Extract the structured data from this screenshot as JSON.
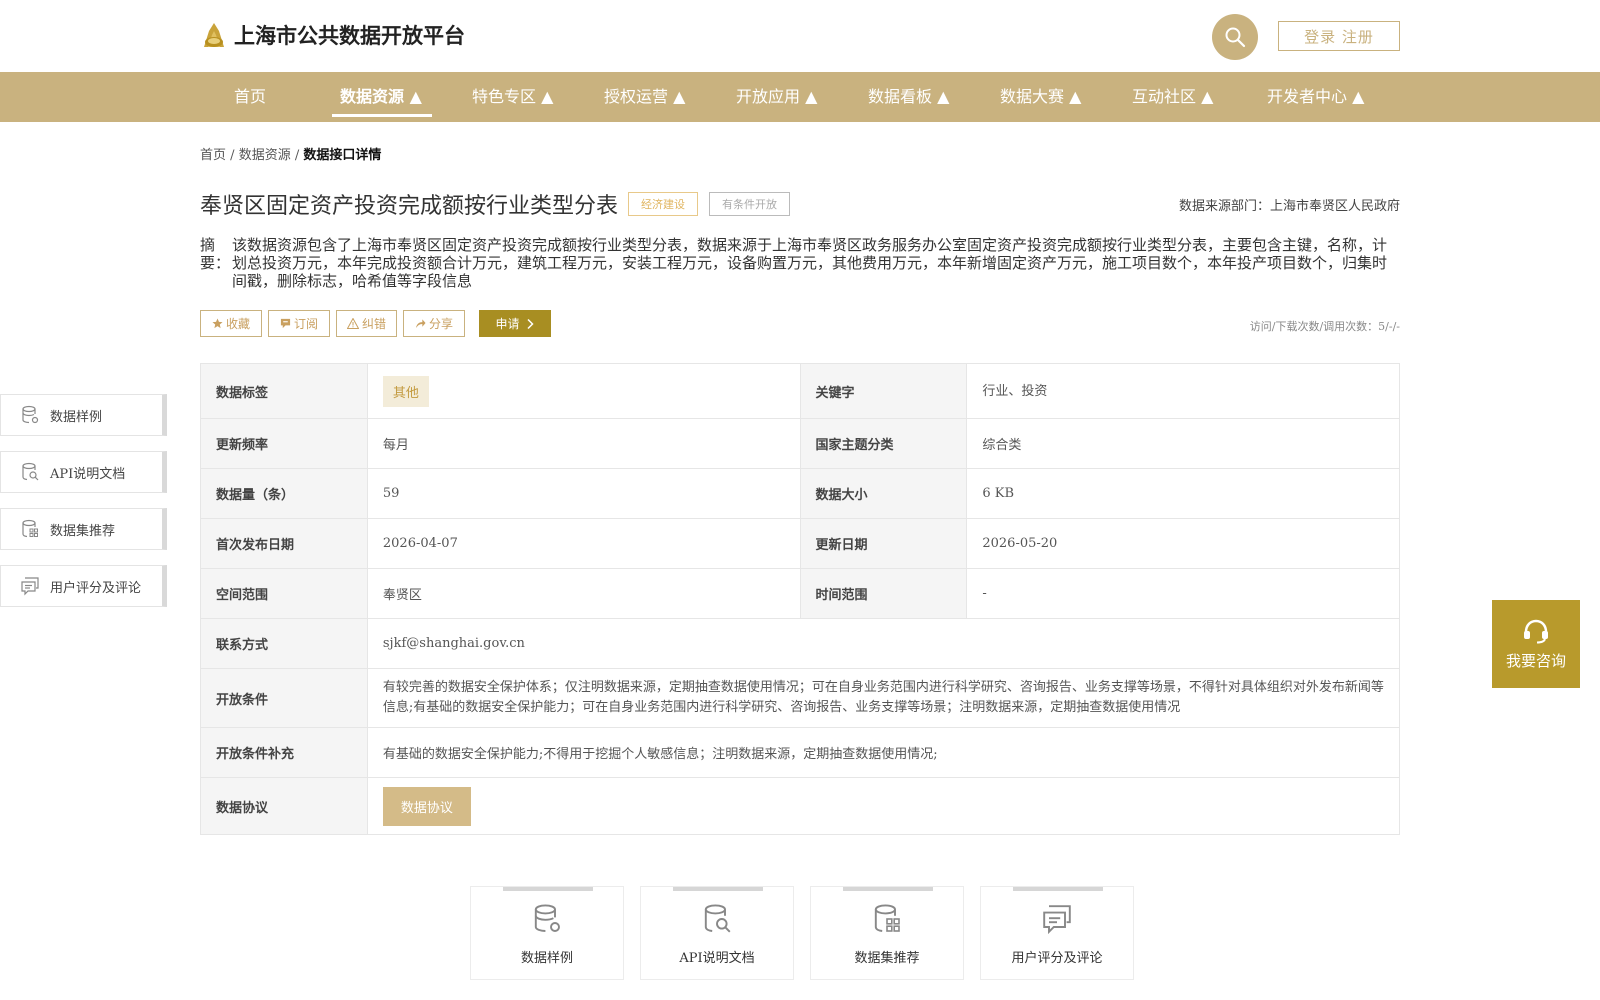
{
  "header": {
    "site_title": "上海市公共数据开放平台",
    "login_label": "登录 注册"
  },
  "nav": {
    "items": [
      "首页",
      "数据资源 ▲",
      "特色专区 ▲",
      "授权运营 ▲",
      "开放应用 ▲",
      "数据看板 ▲",
      "数据大赛 ▲",
      "互动社区 ▲",
      "开发者中心 ▲"
    ],
    "active": "数据资源 ▲"
  },
  "breadcrumb": {
    "home": "首页",
    "sep": "/",
    "section": "数据资源",
    "current": "数据接口详情"
  },
  "dataset": {
    "title": "奉贤区固定资产投资完成额按行业类型分表",
    "tag_topic": "经济建设",
    "tag_open": "有条件开放",
    "source": "数据来源部门：上海市奉贤区人民政府",
    "summary_label": "摘要：",
    "summary": "该数据资源包含了上海市奉贤区固定资产投资完成额按行业类型分表，数据来源于上海市奉贤区政务服务办公室固定资产投资完成额按行业类型分表，主要包含主键，名称，计划总投资万元，本年完成投资额合计万元，建筑工程万元，安装工程万元，设备购置万元，其他费用万元，本年新增固定资产万元，施工项目数个，本年投产项目数个，归集时间戳，删除标志，哈希值等字段信息"
  },
  "actions": {
    "favorite": "收藏",
    "subscribe": "订阅",
    "report": "纠错",
    "share": "分享",
    "apply": "申请",
    "visits": "访问/下载次数/调用次数：5/-/-"
  },
  "table": {
    "data_tag_label": "数据标签",
    "data_tag_value": "其他",
    "keywords_label": "关键字",
    "keywords_value": "行业、投资",
    "freq_label": "更新频率",
    "freq_value": "每月",
    "theme_label": "国家主题分类",
    "theme_value": "综合类",
    "count_label": "数据量（条）",
    "count_value": "59",
    "size_label": "数据大小",
    "size_value": "6 KB",
    "first_pub_label": "首次发布日期",
    "first_pub_value": "2026-04-07",
    "update_label": "更新日期",
    "update_value": "2026-05-20",
    "space_label": "空间范围",
    "space_value": "奉贤区",
    "time_label": "时间范围",
    "time_value": "-",
    "contact_label": "联系方式",
    "contact_value": "sjkf@shanghai.gov.cn",
    "cond_label": "开放条件",
    "cond_value": "有较完善的数据安全保护体系；仅注明数据来源，定期抽查数据使用情况；可在自身业务范围内进行科学研究、咨询报告、业务支撑等场景，不得针对具体组织对外发布新闻等信息;有基础的数据安全保护能力；可在自身业务范围内进行科学研究、咨询报告、业务支撑等场景；注明数据来源，定期抽查数据使用情况",
    "cond_extra_label": "开放条件补充",
    "cond_extra_value": "有基础的数据安全保护能力;不得用于挖掘个人敏感信息；注明数据来源，定期抽查数据使用情况;",
    "protocol_label": "数据协议",
    "protocol_button": "数据协议"
  },
  "side_nav": [
    "数据样例",
    "API说明文档",
    "数据集推荐",
    "用户评分及评论"
  ],
  "consult": "我要咨询",
  "bottom_cards": [
    "数据样例",
    "API说明文档",
    "数据集推荐",
    "用户评分及评论"
  ],
  "colors": {
    "brand": "#c9b27f",
    "apply": "#a88e22",
    "consult": "#b89a2c"
  }
}
